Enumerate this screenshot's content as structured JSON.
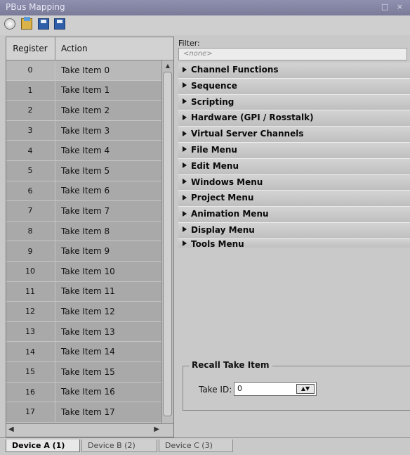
{
  "window": {
    "title": "PBus Mapping",
    "controls": "□ ×"
  },
  "toolbar": {
    "icons": [
      "new-icon",
      "open-icon",
      "save-icon",
      "save-as-icon"
    ]
  },
  "table": {
    "headers": {
      "register": "Register",
      "action": "Action"
    },
    "rows": [
      {
        "register": "0",
        "action": "Take Item 0"
      },
      {
        "register": "1",
        "action": "Take Item 1"
      },
      {
        "register": "2",
        "action": "Take Item 2"
      },
      {
        "register": "3",
        "action": "Take Item 3"
      },
      {
        "register": "4",
        "action": "Take Item 4"
      },
      {
        "register": "5",
        "action": "Take Item 5"
      },
      {
        "register": "6",
        "action": "Take Item 6"
      },
      {
        "register": "7",
        "action": "Take Item 7"
      },
      {
        "register": "8",
        "action": "Take Item 8"
      },
      {
        "register": "9",
        "action": "Take Item 9"
      },
      {
        "register": "10",
        "action": "Take Item 10"
      },
      {
        "register": "11",
        "action": "Take Item 11"
      },
      {
        "register": "12",
        "action": "Take Item 12"
      },
      {
        "register": "13",
        "action": "Take Item 13"
      },
      {
        "register": "14",
        "action": "Take Item 14"
      },
      {
        "register": "15",
        "action": "Take Item 15"
      },
      {
        "register": "16",
        "action": "Take Item 16"
      },
      {
        "register": "17",
        "action": "Take Item 17"
      }
    ]
  },
  "filter": {
    "label": "Filter:",
    "value": "<none>"
  },
  "categories": [
    "Channel Functions",
    "Sequence",
    "Scripting",
    "Hardware (GPI / Rosstalk)",
    "Virtual Server Channels",
    "File Menu",
    "Edit Menu",
    "Windows Menu",
    "Project Menu",
    "Animation Menu",
    "Display Menu",
    "Tools Menu"
  ],
  "recall": {
    "title": "Recall Take Item",
    "take_id_label": "Take ID:",
    "take_id_value": "0"
  },
  "tabs": [
    {
      "label": "Device A (1)",
      "active": true
    },
    {
      "label": "Device B (2)",
      "active": false
    },
    {
      "label": "Device C (3)",
      "active": false
    }
  ]
}
